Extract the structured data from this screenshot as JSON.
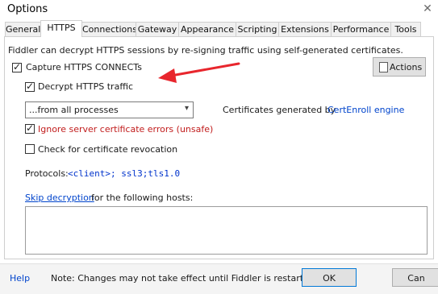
{
  "window": {
    "title": "Options",
    "close_glyph": "✕"
  },
  "tabs": [
    {
      "label": "General"
    },
    {
      "label": "HTTPS"
    },
    {
      "label": "Connections"
    },
    {
      "label": "Gateway"
    },
    {
      "label": "Appearance"
    },
    {
      "label": "Scripting"
    },
    {
      "label": "Extensions"
    },
    {
      "label": "Performance"
    },
    {
      "label": "Tools"
    }
  ],
  "https": {
    "description": "Fiddler can decrypt HTTPS sessions by re-signing traffic using self-generated certificates.",
    "actions_label": "Actions",
    "capture_connects": {
      "label": "Capture HTTPS CONNECTs",
      "checked": true
    },
    "decrypt_traffic": {
      "label": "Decrypt HTTPS traffic",
      "checked": true
    },
    "process_filter": {
      "selected": "...from all processes"
    },
    "certificates_prefix": "Certificates generated by",
    "certificates_engine": "CertEnroll engine",
    "ignore_errors": {
      "label": "Ignore server certificate errors (unsafe)",
      "checked": true
    },
    "check_revocation": {
      "label": "Check for certificate revocation",
      "checked": false
    },
    "protocols_label": "Protocols:",
    "protocols_value": "<client>; ssl3;tls1.0",
    "skip_link": "Skip decryption",
    "skip_rest": "for the following hosts:"
  },
  "footer": {
    "help": "Help",
    "note": "Note: Changes may not take effect until Fiddler is restarted.",
    "ok": "OK",
    "cancel": "Can"
  },
  "colors": {
    "annotation_arrow": "#e8262d",
    "link": "#0044cc",
    "warning": "#c11c1c"
  }
}
